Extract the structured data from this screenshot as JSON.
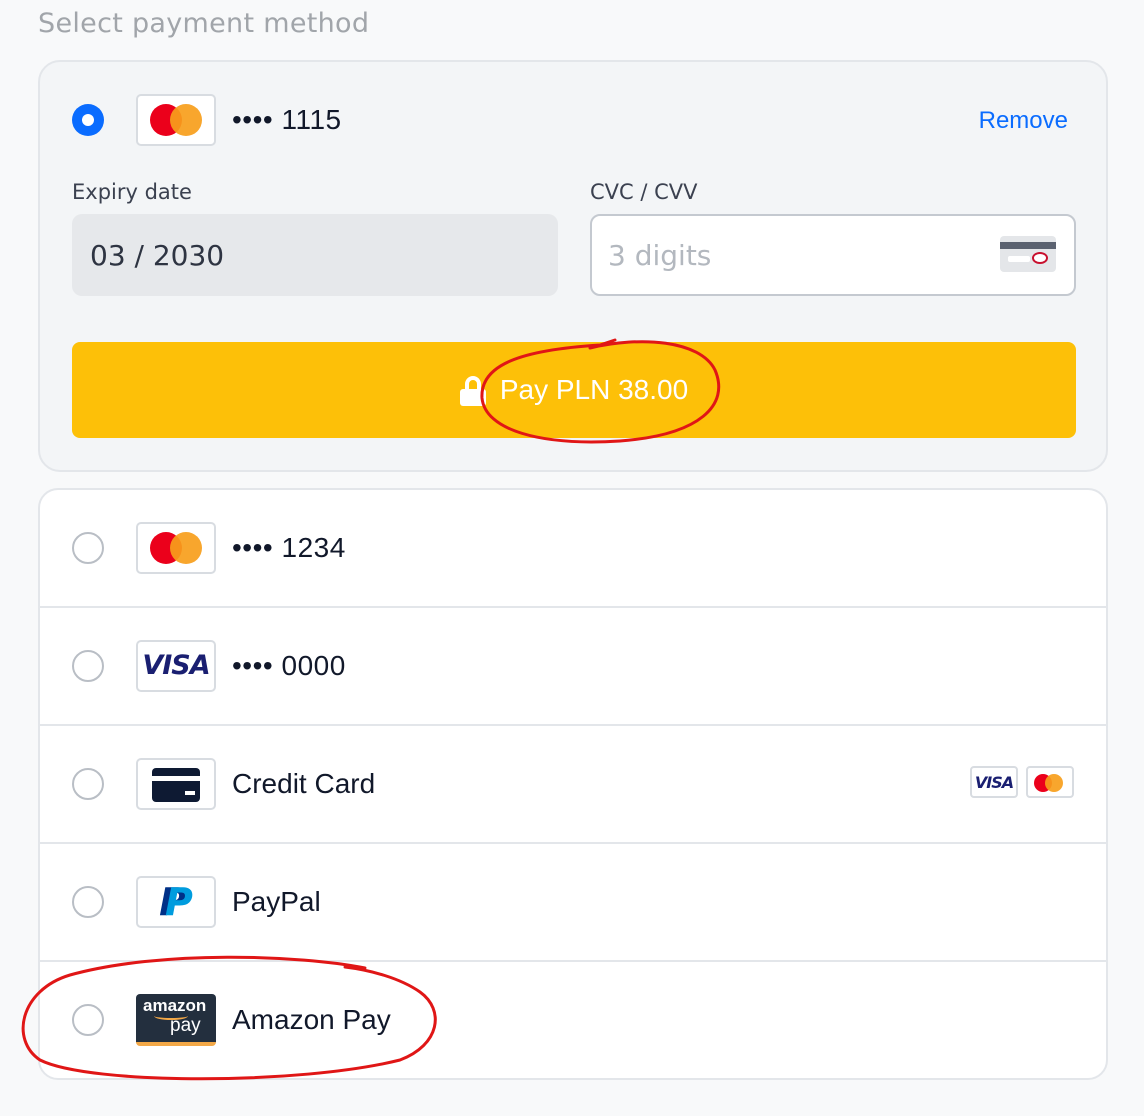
{
  "header": {
    "title": "Select payment method"
  },
  "selected_card": {
    "masked_number": "•••• 1115",
    "remove_label": "Remove",
    "expiry": {
      "label": "Expiry date",
      "value": "03 / 2030"
    },
    "cvc": {
      "label": "CVC / CVV",
      "placeholder": "3 digits"
    },
    "pay_button_label": "Pay PLN 38.00",
    "brand": "mastercard"
  },
  "methods": [
    {
      "label": "•••• 1234",
      "brand": "mastercard"
    },
    {
      "label": "•••• 0000",
      "brand": "visa",
      "logo_text": "VISA"
    },
    {
      "label": "Credit Card",
      "brand": "generic-card",
      "accepted": [
        {
          "logo_text": "VISA"
        },
        {
          "brand": "mastercard"
        }
      ]
    },
    {
      "label": "PayPal",
      "brand": "paypal"
    },
    {
      "label": "Amazon Pay",
      "brand": "amazon-pay",
      "logo_text": "amazon",
      "logo_subtext": "pay"
    }
  ],
  "colors": {
    "accent": "#0a6cff",
    "pay_button": "#fdc008",
    "annotation": "#e01616"
  }
}
